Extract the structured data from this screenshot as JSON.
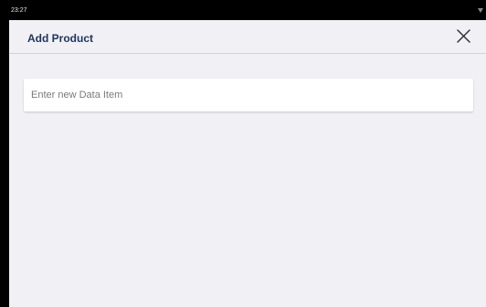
{
  "status_bar": {
    "time": "23:27"
  },
  "header": {
    "title": "Add Product",
    "close_icon": "close-icon"
  },
  "form": {
    "item_input": {
      "value": "",
      "placeholder": "Enter new Data Item"
    }
  },
  "colors": {
    "background": "#f1f1f5",
    "title_text": "#1f355e",
    "status_bar": "#000000"
  }
}
